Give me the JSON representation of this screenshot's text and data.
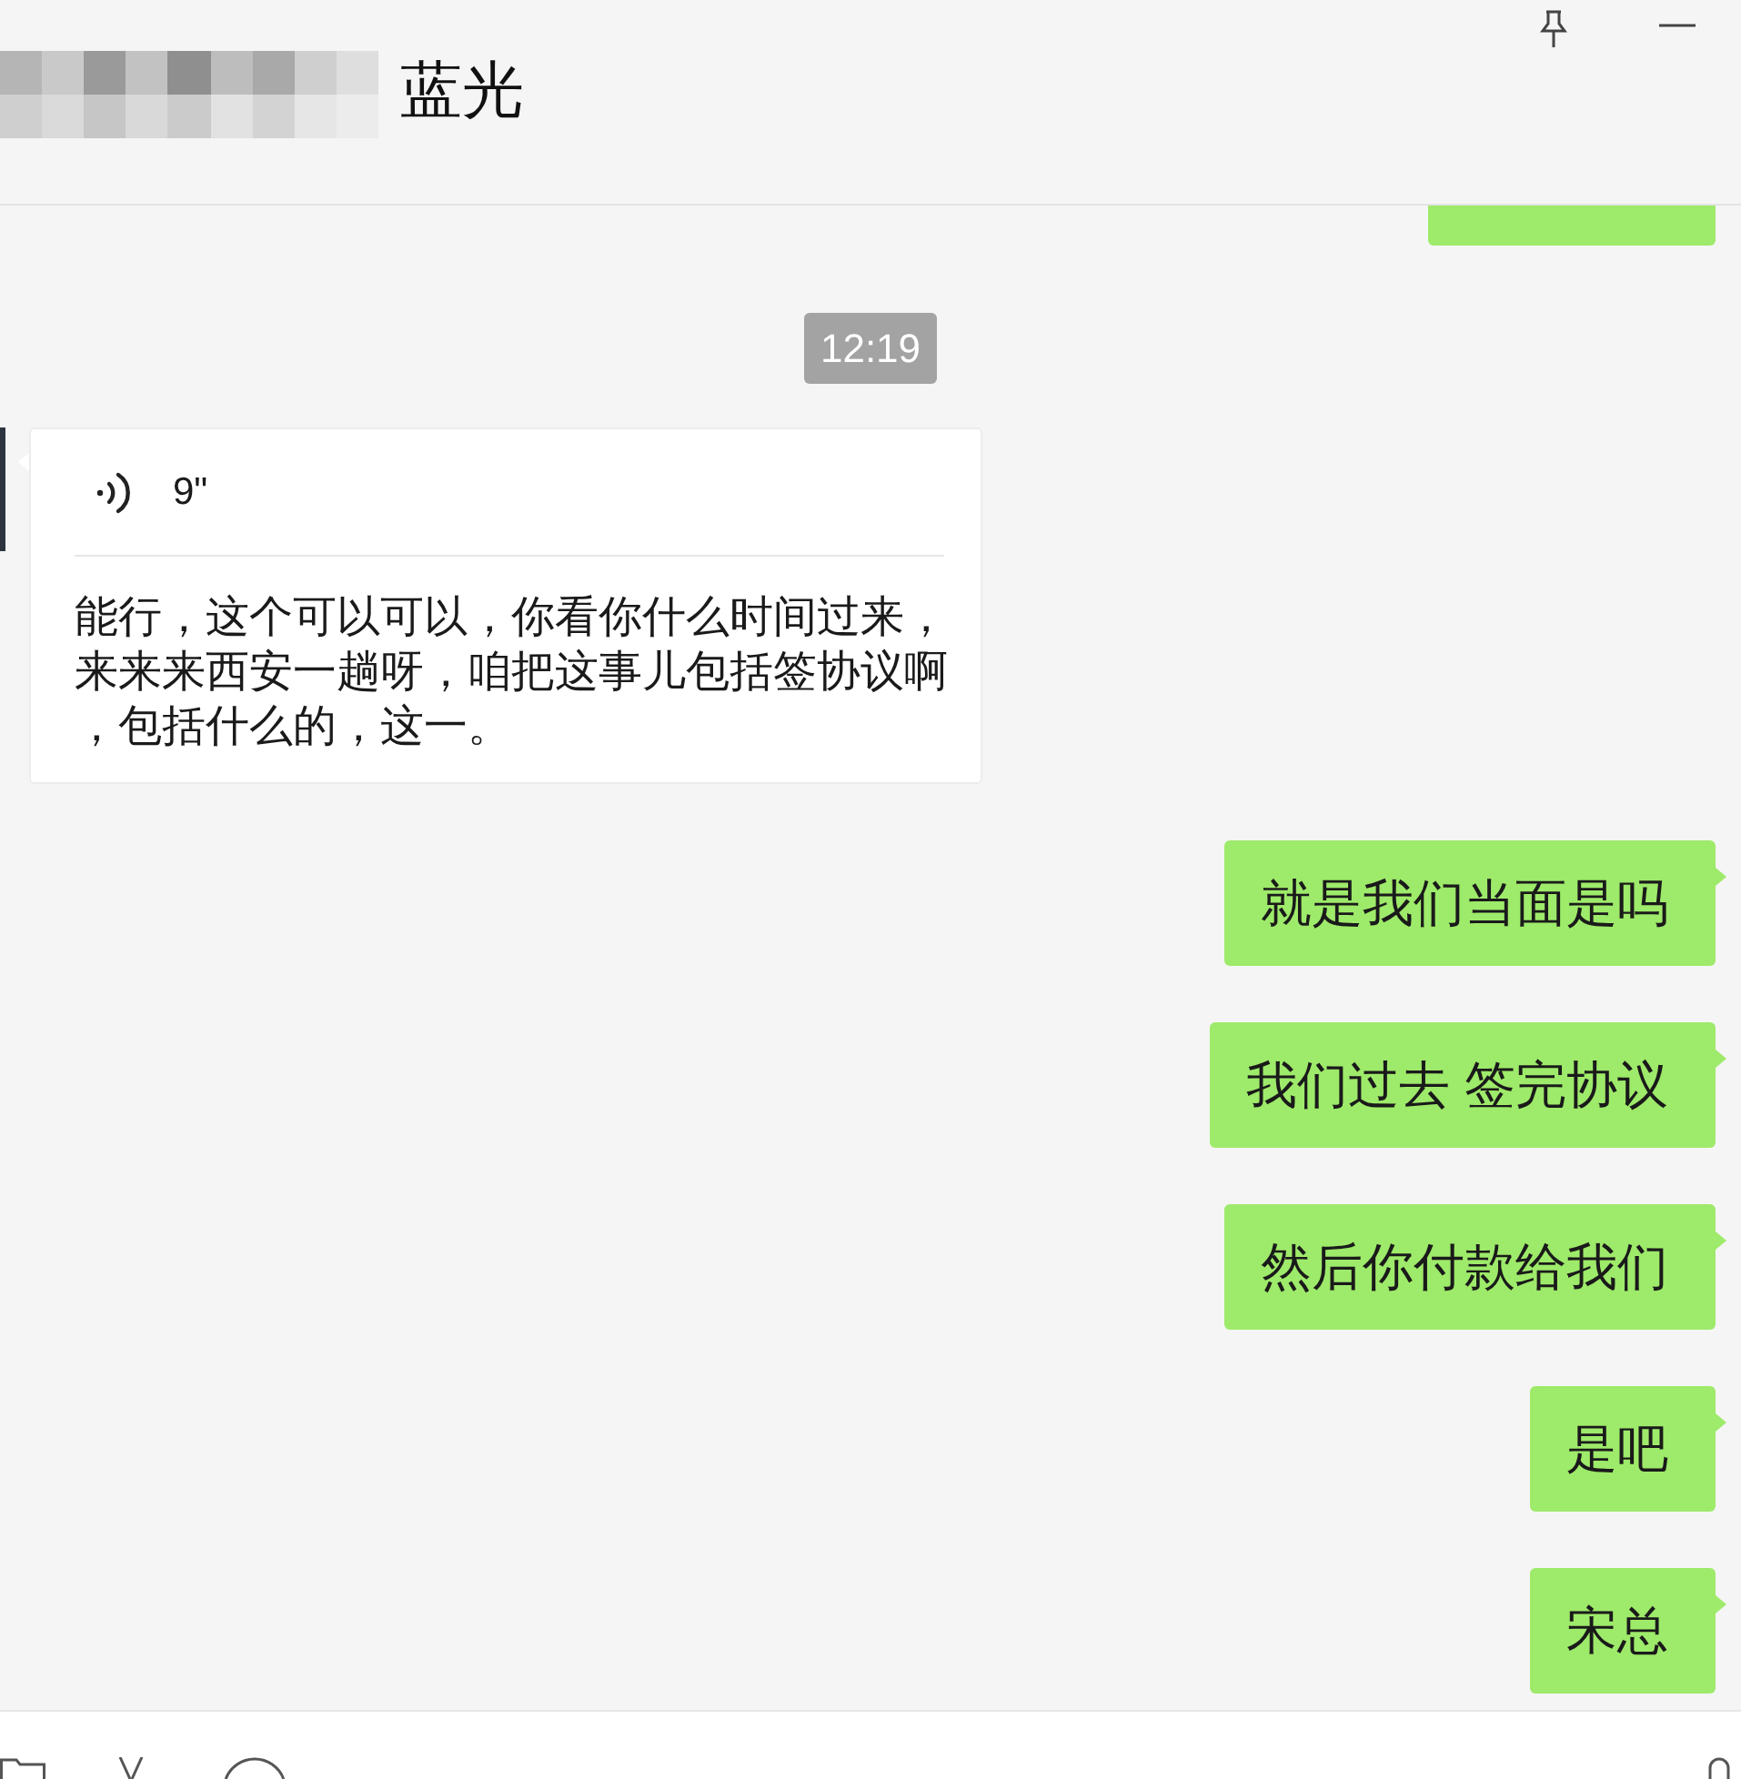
{
  "window": {
    "title": "蓝光"
  },
  "messages": [
    {
      "kind": "clipped"
    },
    {
      "kind": "time",
      "text": "12:19"
    },
    {
      "kind": "voice",
      "duration": "9\"",
      "transcript": "能行，这个可以可以，你看你什么时间过来，来来来西安一趟呀，咱把这事儿包括签协议啊，包括什么的，这一。"
    },
    {
      "kind": "text",
      "text": "就是我们当面是吗"
    },
    {
      "kind": "text",
      "text": "我们过去 签完协议"
    },
    {
      "kind": "text",
      "text": "然后你付款给我们"
    },
    {
      "kind": "text",
      "text": "是吧"
    },
    {
      "kind": "text",
      "text": "宋总"
    }
  ]
}
